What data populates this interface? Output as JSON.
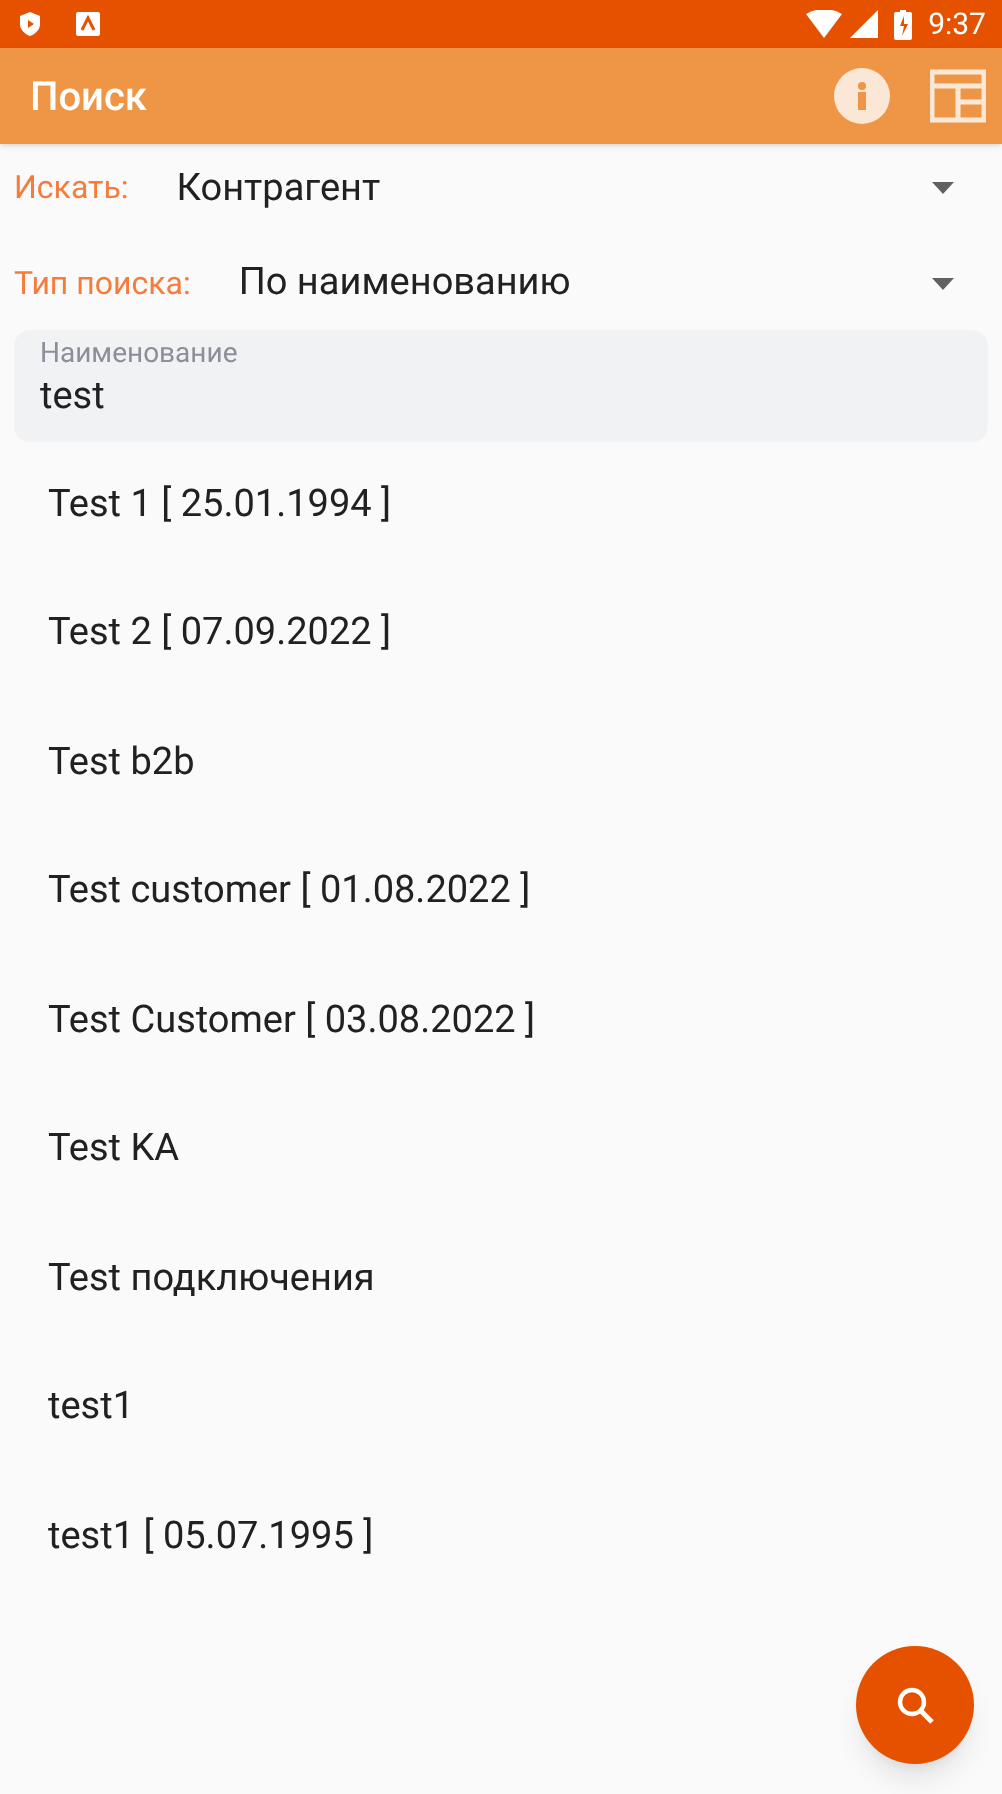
{
  "status_bar": {
    "time": "9:37"
  },
  "app_bar": {
    "title": "Поиск"
  },
  "filters": [
    {
      "label": "Искать:",
      "value": "Контрагент"
    },
    {
      "label": "Тип поиска:",
      "value": "По наименованию"
    }
  ],
  "search_field": {
    "label": "Наименование",
    "value": "test"
  },
  "results": [
    "Test 1 [ 25.01.1994 ]",
    "Test 2 [ 07.09.2022 ]",
    "Test b2b",
    "Test customer [ 01.08.2022 ]",
    "Test Customer [ 03.08.2022 ]",
    "Test KA",
    "Test подключения",
    "test1",
    "test1 [ 05.07.1995 ]"
  ]
}
